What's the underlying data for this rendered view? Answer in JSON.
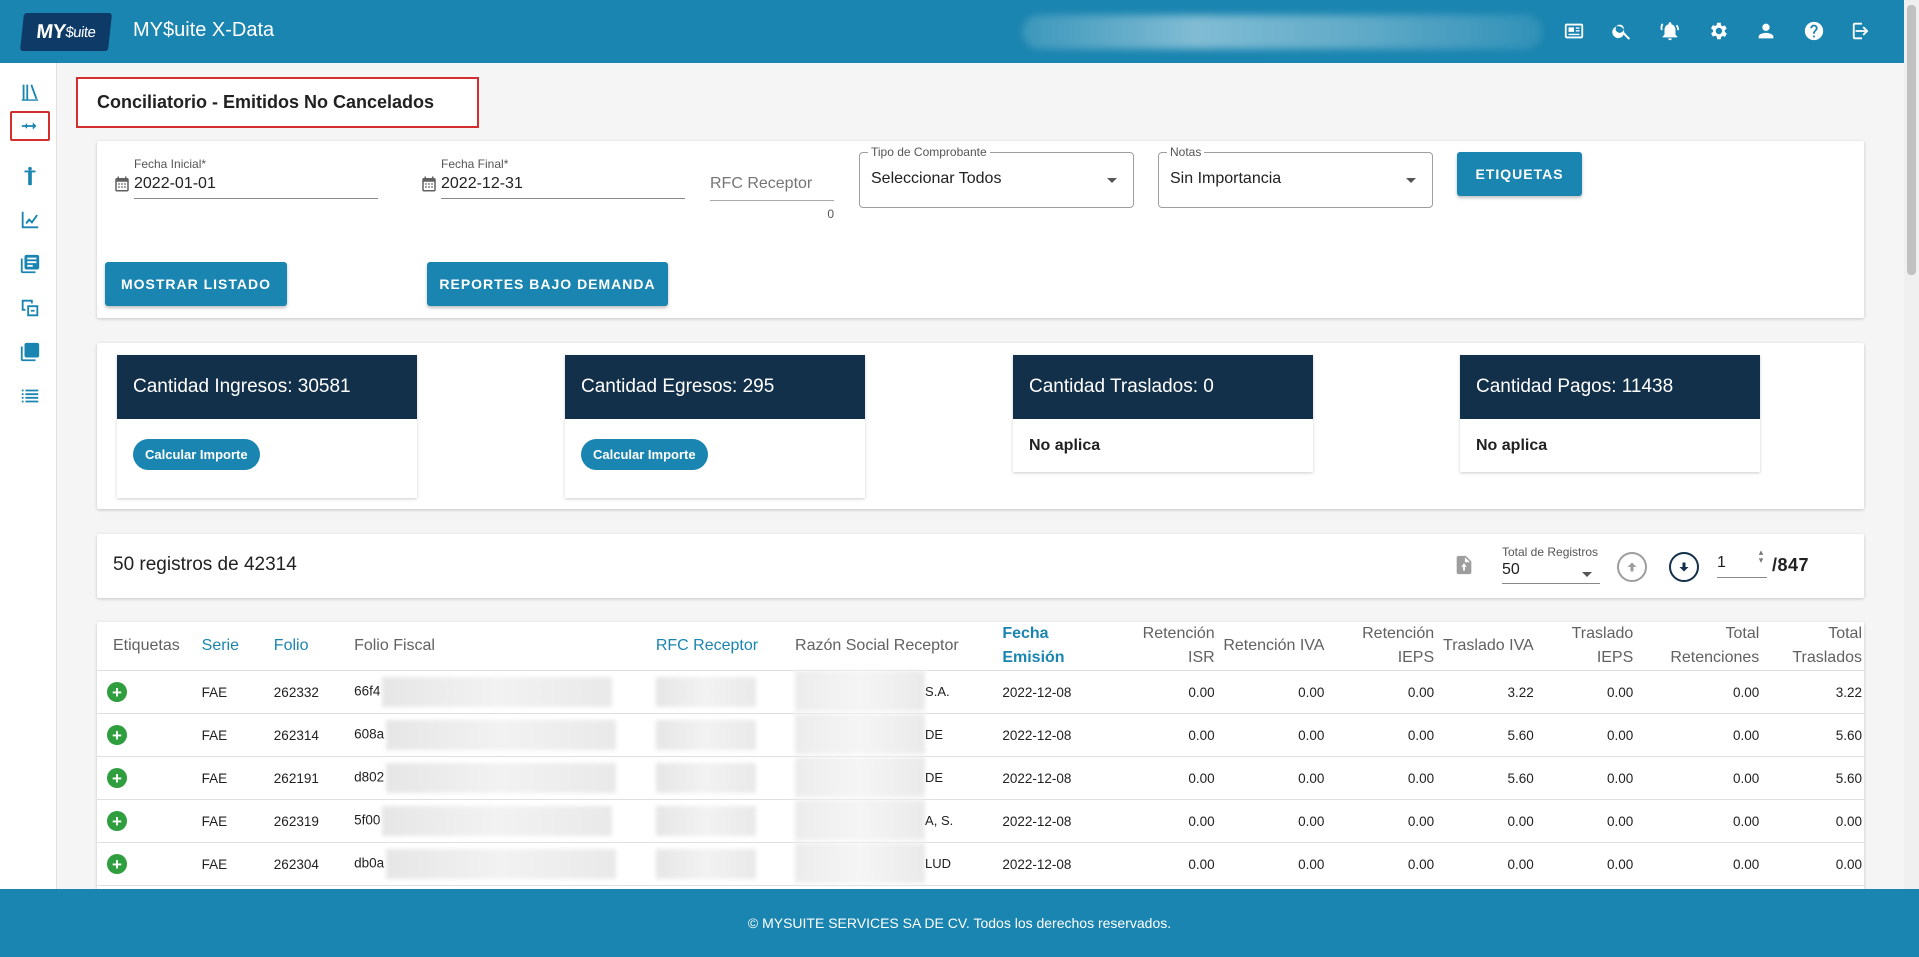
{
  "header": {
    "logo_text": "MY",
    "logo_suffix": "$uite",
    "title": "MY$uite X-Data",
    "icons": [
      "news-icon",
      "search-icon",
      "notifications-icon",
      "settings-icon",
      "user-icon",
      "help-icon",
      "logout-icon"
    ]
  },
  "sidebar": {
    "items": [
      "library-icon",
      "conciliation-icon",
      "person-icon",
      "chart-icon",
      "list-icon",
      "compare-icon",
      "layers-icon",
      "table-icon"
    ],
    "active_index": 1
  },
  "page": {
    "title": "Conciliatorio - Emitidos No Cancelados"
  },
  "filters": {
    "fecha_inicial_label": "Fecha Inicial*",
    "fecha_inicial": "2022-01-01",
    "fecha_final_label": "Fecha Final*",
    "fecha_final": "2022-12-31",
    "rfc_placeholder": "RFC Receptor",
    "rfc_counter": "0",
    "tipo_label": "Tipo de Comprobante",
    "tipo_value": "Seleccionar Todos",
    "notas_label": "Notas",
    "notas_value": "Sin Importancia",
    "etiquetas_button": "ETIQUETAS",
    "mostrar_button": "MOSTRAR LISTADO",
    "reportes_button": "REPORTES BAJO DEMANDA"
  },
  "stats": [
    {
      "title": "Cantidad Ingresos: 30581",
      "action": "Calcular Importe"
    },
    {
      "title": "Cantidad Egresos: 295",
      "action": "Calcular Importe"
    },
    {
      "title": "Cantidad Traslados: 0",
      "note": "No aplica"
    },
    {
      "title": "Cantidad Pagos: 11438",
      "note": "No aplica"
    }
  ],
  "records": {
    "summary": "50 registros de 42314",
    "total_label": "Total de Registros",
    "total_value": "50",
    "page": "1",
    "page_total": "/847"
  },
  "table": {
    "columns": [
      "Etiquetas",
      "Serie",
      "Folio",
      "Folio Fiscal",
      "RFC Receptor",
      "Razón Social Receptor",
      "Fecha Emisión",
      "Retención ISR",
      "Retención IVA",
      "Retención IEPS",
      "Traslado IVA",
      "Traslado IEPS",
      "Total Retenciones",
      "Total Traslados"
    ],
    "rows": [
      {
        "serie": "FAE",
        "folio": "262332",
        "folio_fiscal": "66f4",
        "razon": "S.A.",
        "fecha": "2022-12-08",
        "ret_isr": "0.00",
        "ret_iva": "0.00",
        "ret_ieps": "0.00",
        "tras_iva": "3.22",
        "tras_ieps": "0.00",
        "tot_ret": "0.00",
        "tot_tras": "3.22"
      },
      {
        "serie": "FAE",
        "folio": "262314",
        "folio_fiscal": "608a",
        "razon": "DE",
        "fecha": "2022-12-08",
        "ret_isr": "0.00",
        "ret_iva": "0.00",
        "ret_ieps": "0.00",
        "tras_iva": "5.60",
        "tras_ieps": "0.00",
        "tot_ret": "0.00",
        "tot_tras": "5.60"
      },
      {
        "serie": "FAE",
        "folio": "262191",
        "folio_fiscal": "d802",
        "razon": "DE",
        "fecha": "2022-12-08",
        "ret_isr": "0.00",
        "ret_iva": "0.00",
        "ret_ieps": "0.00",
        "tras_iva": "5.60",
        "tras_ieps": "0.00",
        "tot_ret": "0.00",
        "tot_tras": "5.60"
      },
      {
        "serie": "FAE",
        "folio": "262319",
        "folio_fiscal": "5f00",
        "razon": "A, S.",
        "fecha": "2022-12-08",
        "ret_isr": "0.00",
        "ret_iva": "0.00",
        "ret_ieps": "0.00",
        "tras_iva": "0.00",
        "tras_ieps": "0.00",
        "tot_ret": "0.00",
        "tot_tras": "0.00"
      },
      {
        "serie": "FAE",
        "folio": "262304",
        "folio_fiscal": "db0a",
        "razon": "LUD",
        "fecha": "2022-12-08",
        "ret_isr": "0.00",
        "ret_iva": "0.00",
        "ret_ieps": "0.00",
        "tras_iva": "0.00",
        "tras_ieps": "0.00",
        "tot_ret": "0.00",
        "tot_tras": "0.00"
      }
    ]
  },
  "footer": {
    "text": "© MYSUITE SERVICES SA DE CV. Todos los derechos reservados."
  },
  "colors": {
    "primary": "#1a85b0",
    "dark": "#13304a",
    "success": "#2e9e3e",
    "highlight": "#d32f2f"
  }
}
